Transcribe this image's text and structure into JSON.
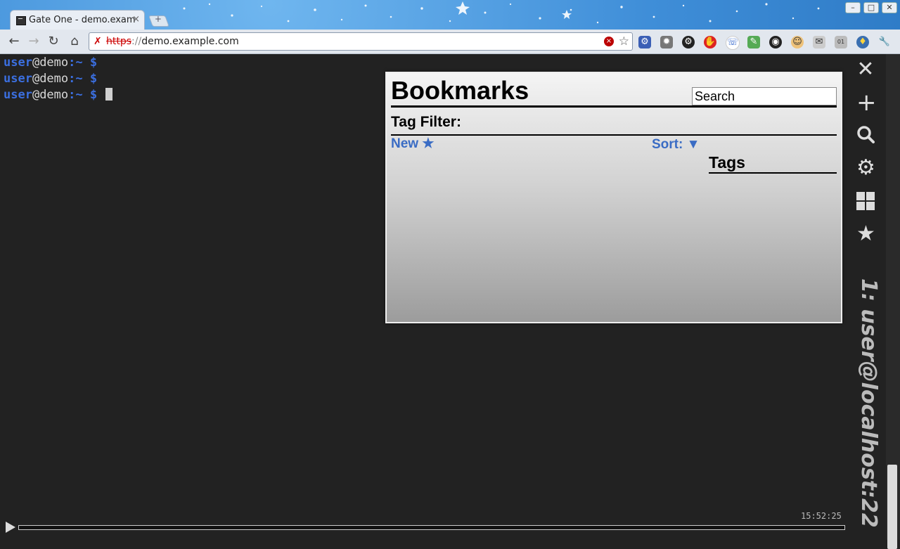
{
  "browser": {
    "tab_title": "Gate One - demo.exam",
    "tab_close": "×",
    "new_tab": "+",
    "url_proto": "https",
    "url_sep": "://",
    "url_host": "demo.example.com",
    "window_controls": [
      "–",
      "□",
      "✕"
    ]
  },
  "terminal": {
    "lines": [
      {
        "user": "user",
        "host": "@demo",
        "path": ":~ $"
      },
      {
        "user": "user",
        "host": "@demo",
        "path": ":~ $"
      },
      {
        "user": "user",
        "host": "@demo",
        "path": ":~ $"
      }
    ],
    "clock": "15:52:25",
    "title": "1: user@localhost:22"
  },
  "bookmarks": {
    "title": "Bookmarks",
    "search_placeholder": "Search",
    "tag_filter": "Tag Filter:",
    "new_label": "New ★",
    "sort_label": "Sort: ▼",
    "tags_heading": "Tags"
  },
  "sidebar_icons": [
    "close-icon",
    "plus-icon",
    "search-icon",
    "gear-icon",
    "grid-icon",
    "star-icon"
  ],
  "colors": {
    "terminal_bg": "#222222",
    "prompt_blue": "#3b6fe0",
    "link_blue": "#3a6cc4"
  }
}
